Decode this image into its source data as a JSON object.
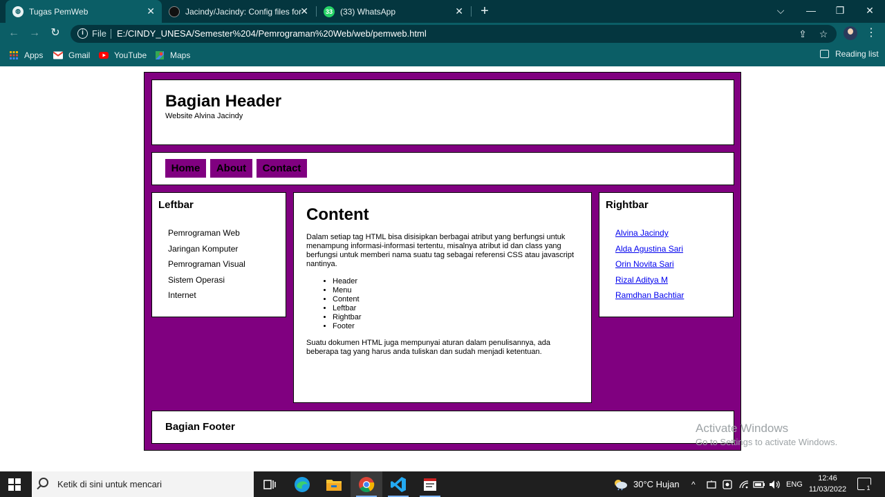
{
  "browser": {
    "tabs": [
      {
        "title": "Tugas PemWeb",
        "close": "✕"
      },
      {
        "title": "Jacindy/Jacindy: Config files for m",
        "close": "✕"
      },
      {
        "title": "(33) WhatsApp",
        "close": "✕",
        "badge": "33"
      }
    ],
    "new_tab": "+",
    "window_controls": {
      "chevron": "⌵",
      "minimize": "—",
      "restore": "❐",
      "close": "✕"
    },
    "nav": {
      "back": "←",
      "forward": "→",
      "reload": "↻"
    },
    "omnibox": {
      "info": "i",
      "scheme_label": "File",
      "url": "E:/CINDY_UNESA/Semester%204/Pemrograman%20Web/web/pemweb.html",
      "share": "⇪",
      "star": "☆"
    },
    "menu": "⋮",
    "bookmarks": [
      {
        "label": "Apps",
        "icon": "apps-grid-icon"
      },
      {
        "label": "Gmail",
        "icon": "gmail-icon"
      },
      {
        "label": "YouTube",
        "icon": "youtube-icon"
      },
      {
        "label": "Maps",
        "icon": "maps-icon"
      }
    ],
    "reading_list": "Reading list",
    "colors": {
      "frame": "#04363f",
      "toolbar": "#0b5e66"
    }
  },
  "page": {
    "header": {
      "title": "Bagian Header",
      "subtitle": "Website Alvina Jacindy"
    },
    "menu": [
      "Home",
      "About",
      "Contact"
    ],
    "leftbar": {
      "title": "Leftbar",
      "items": [
        "Pemrograman Web",
        "Jaringan Komputer",
        "Pemrograman Visual",
        "Sistem Operasi",
        "Internet"
      ]
    },
    "content": {
      "title": "Content",
      "para1": "Dalam setiap tag HTML bisa disisipkan berbagai atribut yang berfungsi untuk menampung informasi-informasi tertentu, misalnya atribut id dan class yang berfungsi untuk memberi nama suatu tag sebagai referensi CSS atau javascript nantinya.",
      "list": [
        "Header",
        "Menu",
        "Content",
        "Leftbar",
        "Rightbar",
        "Footer"
      ],
      "para2": "Suatu dokumen HTML juga mempunyai aturan dalam penulisannya, ada beberapa tag yang harus anda tuliskan dan sudah menjadi ketentuan."
    },
    "rightbar": {
      "title": "Rightbar",
      "links": [
        "Alvina Jacindy",
        "Alda Agustina Sari",
        "Orin Novita Sari",
        "Rizal Aditya M",
        "Ramdhan Bachtiar"
      ]
    },
    "footer": {
      "title": "Bagian Footer"
    },
    "colors": {
      "accent": "#800080",
      "link": "#0000ee"
    }
  },
  "watermark": {
    "line1": "Activate Windows",
    "line2": "Go to Settings to activate Windows."
  },
  "taskbar": {
    "search_placeholder": "Ketik di sini untuk mencari",
    "apps": [
      "task-view",
      "edge",
      "file-explorer",
      "chrome",
      "vscode",
      "notepad"
    ],
    "weather": "30°C  Hujan",
    "language": "ENG",
    "time": "12:46",
    "date": "11/03/2022",
    "notification_count": "1"
  }
}
